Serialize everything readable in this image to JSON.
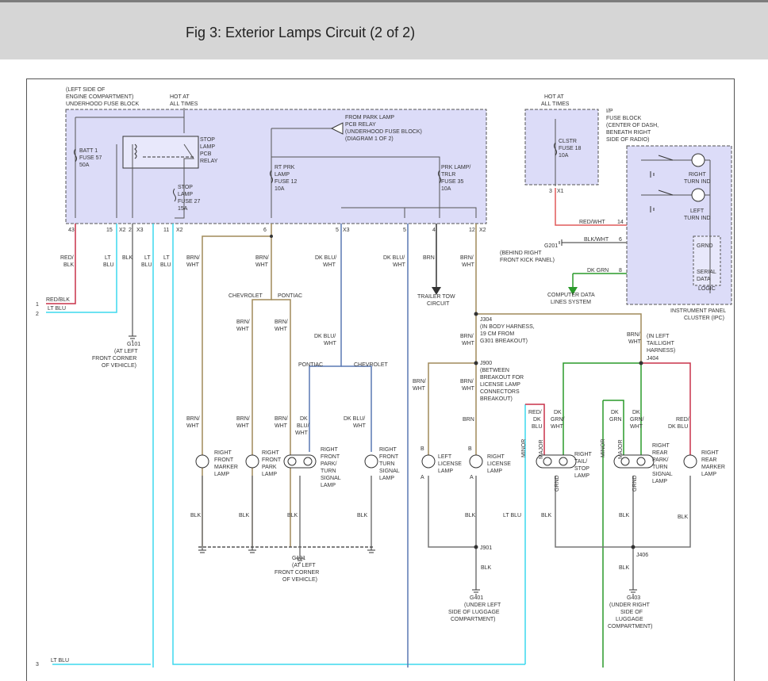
{
  "title": "Fig 3: Exterior Lamps Circuit (2 of 2)",
  "colors": {
    "header_bg": "#d6d6d6",
    "box_fill": "#dcdcf8",
    "brn_wht": "#a08a5a",
    "red_blk": "#c8324a",
    "lt_blu": "#3dd8ee",
    "dk_blu_wht": "#5a78b4",
    "red_wht": "#e05a5a",
    "dk_grn": "#2a9a2a",
    "wire_grey": "#888888"
  },
  "fuse_block": {
    "note": [
      "(LEFT SIDE OF",
      "ENGINE COMPARTMENT)",
      "UNDERHOOD FUSE BLOCK"
    ],
    "hot": [
      "HOT AT",
      "ALL TIMES"
    ],
    "batt": [
      "BATT 1",
      "FUSE 57",
      "50A"
    ],
    "relay": [
      "STOP",
      "LAMP",
      "PCB",
      "RELAY"
    ],
    "stop_fuse": [
      "STOP",
      "LAMP",
      "FUSE 27",
      "15A"
    ],
    "from_park": [
      "FROM PARK LAMP",
      "PCB RELAY",
      "(UNDERHOOD FUSE BLOCK)",
      "(DIAGRAM 1 OF 2)"
    ],
    "rt_prk": [
      "RT PRK",
      "LAMP",
      "FUSE 12",
      "10A"
    ],
    "prk_trlr": [
      "PRK LAMP/",
      "TRLR",
      "FUSE 35",
      "10A"
    ],
    "pins": [
      "43",
      "15",
      "X2",
      "2",
      "X3",
      "11",
      "X2",
      "6",
      "5",
      "X3",
      "5",
      "4",
      "12",
      "X2"
    ]
  },
  "ip_fuse_block": {
    "hot": [
      "HOT AT",
      "ALL TIMES"
    ],
    "note": [
      "I/P",
      "FUSE BLOCK",
      "(CENTER OF DASH,",
      "BENEATH RIGHT",
      "SIDE OF RADIO)"
    ],
    "clstr": [
      "CLSTR",
      "FUSE 18",
      "10A"
    ],
    "pins": [
      "3",
      "X1"
    ]
  },
  "ipc": {
    "right_turn": [
      "RIGHT",
      "TURN IND"
    ],
    "left_turn": [
      "LEFT",
      "TURN IND"
    ],
    "grnd": "GRND",
    "serial": [
      "SERIAL",
      "DATA"
    ],
    "logic": "LOGIC",
    "caption": [
      "INSTRUMENT PANEL",
      "CLUSTER (IPC)"
    ],
    "pins": [
      "14",
      "6",
      "8"
    ]
  },
  "labels": {
    "red_wht": "RED/WHT",
    "blk_wht": "BLK/WHT",
    "dk_grn": "DK GRN",
    "g201": "G201",
    "g201_note": [
      "(BEHIND RIGHT",
      "FRONT KICK PANEL)"
    ],
    "computer": [
      "COMPUTER DATA",
      "LINES SYSTEM"
    ],
    "red_blk": "RED/BLK",
    "lt_blu": "LT BLU",
    "in1": "1",
    "in2": "2",
    "in3": "3",
    "chevrolet": "CHEVROLET",
    "pontiac": "PONTIAC",
    "trailer": [
      "TRAILER TOW",
      "CIRCUIT"
    ],
    "brn": "BRN",
    "blk": "BLK",
    "j304": "J304",
    "j304_note": [
      "(IN BODY HARNESS,",
      "19 CM FROM",
      "G301 BREAKOUT)"
    ],
    "j900": "J900",
    "j900_note": [
      "(BETWEEN",
      "BREAKOUT FOR",
      "LICENSE LAMP",
      "CONNECTORS",
      "BREAKOUT)"
    ],
    "j404": "J404",
    "j404_note": [
      "(IN LEFT",
      "TAILLIGHT",
      "HARNESS)"
    ],
    "j901": "J901",
    "j406": "J406",
    "g101": "G101",
    "g101_top_note": [
      "(AT LEFT",
      "FRONT CORNER",
      "OF VEHICLE)"
    ],
    "g401": "G401",
    "g401_note": [
      "(UNDER LEFT",
      "SIDE OF LUGGAGE",
      "COMPARTMENT)"
    ],
    "g403": "G403",
    "g403_note": [
      "(UNDER RIGHT",
      "SIDE OF",
      "LUGGAGE",
      "COMPARTMENT)"
    ],
    "minor": "MINOR",
    "major": "MAJOR",
    "grnd": "GRND",
    "a": "A",
    "b": "B"
  },
  "wire_labels": {
    "red_blk_stack": [
      "RED/",
      "BLK"
    ],
    "lt_blu_stack": [
      "LT",
      "BLU"
    ],
    "brn_wht_stack": [
      "BRN/",
      "WHT"
    ],
    "dk_blu_wht_stack": [
      "DK BLU/",
      "WHT"
    ],
    "dk_blu_wht_split": [
      "DK",
      "BLU/",
      "WHT"
    ],
    "red_dk_blu": [
      "RED/",
      "DK",
      "BLU"
    ],
    "dk_grn_wht": [
      "DK",
      "GRN/",
      "WHT"
    ],
    "dk_grn_stack": [
      "DK",
      "GRN"
    ],
    "red_dk_blu_r": [
      "RED/",
      "DK BLU"
    ]
  },
  "lamps": {
    "rf_marker": [
      "RIGHT",
      "FRONT",
      "MARKER",
      "LAMP"
    ],
    "rf_park": [
      "RIGHT",
      "FRONT",
      "PARK",
      "LAMP"
    ],
    "rf_park_turn": [
      "RIGHT",
      "FRONT",
      "PARK/",
      "TURN",
      "SIGNAL",
      "LAMP"
    ],
    "rf_turn": [
      "RIGHT",
      "FRONT",
      "TURN",
      "SIGNAL",
      "LAMP"
    ],
    "l_license": [
      "LEFT",
      "LICENSE",
      "LAMP"
    ],
    "r_license": [
      "RIGHT",
      "LICENSE",
      "LAMP"
    ],
    "r_tail": [
      "RIGHT",
      "TAIL/",
      "STOP",
      "LAMP"
    ],
    "r_rear_park": [
      "RIGHT",
      "REAR",
      "PARK/",
      "TURN",
      "SIGNAL",
      "LAMP"
    ],
    "r_rear_marker": [
      "RIGHT",
      "REAR",
      "MARKER",
      "LAMP"
    ]
  }
}
